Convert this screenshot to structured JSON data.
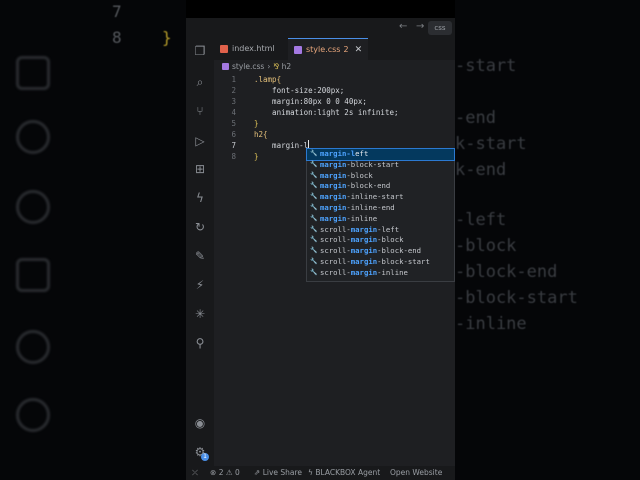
{
  "background": {
    "left_line_numbers": [
      "7",
      "8"
    ],
    "left_braces": [
      "}"
    ],
    "right_lines": [
      "-start",
      "-end",
      "k-start",
      "k-end",
      "-left",
      "-block",
      "-block-end",
      "-block-start",
      "-inline"
    ]
  },
  "titlebar": {
    "back": "←",
    "forward": "→",
    "command_label": "css"
  },
  "tabs": [
    {
      "label": "index.html",
      "badge": "",
      "active": false,
      "icon_color": "#e0614b"
    },
    {
      "label": "style.css",
      "badge": "2",
      "active": true,
      "icon_color": "#a479e2"
    }
  ],
  "breadcrumb": {
    "file": "style.css",
    "symbol_icon": "⅋",
    "symbol": "h2"
  },
  "code_lines": [
    {
      "n": "1",
      "text": ".lamp{"
    },
    {
      "n": "2",
      "text": "    font-size:200px;"
    },
    {
      "n": "3",
      "text": "    margin:80px 0 0 40px;"
    },
    {
      "n": "4",
      "text": "    animation:light 2s infinite;"
    },
    {
      "n": "5",
      "text": "}"
    },
    {
      "n": "6",
      "text": "h2{"
    },
    {
      "n": "7",
      "text": "    margin-l"
    },
    {
      "n": "8",
      "text": "}"
    }
  ],
  "suggestions": [
    {
      "pre": "",
      "match": "margin-l",
      "post": "eft"
    },
    {
      "pre": "",
      "match": "margin",
      "post": "-block-start"
    },
    {
      "pre": "",
      "match": "margin",
      "post": "-block"
    },
    {
      "pre": "",
      "match": "margin",
      "post": "-block-end"
    },
    {
      "pre": "",
      "match": "margin",
      "post": "-inline-start"
    },
    {
      "pre": "",
      "match": "margin",
      "post": "-inline-end"
    },
    {
      "pre": "",
      "match": "margin",
      "post": "-inline"
    },
    {
      "pre": "scroll-",
      "match": "margin",
      "post": "-left"
    },
    {
      "pre": "scroll-",
      "match": "margin",
      "post": "-block"
    },
    {
      "pre": "scroll-",
      "match": "margin",
      "post": "-block-end"
    },
    {
      "pre": "scroll-",
      "match": "margin",
      "post": "-block-start"
    },
    {
      "pre": "scroll-",
      "match": "margin",
      "post": "-inline"
    }
  ],
  "statusbar": {
    "remote": "⤫",
    "errors": "2",
    "warnings": "0",
    "live_share": "Live Share",
    "blackbox": "BLACKBOX Agent",
    "open_website": "Open Website"
  },
  "activity_badge": "1",
  "accent": "#4a8fe7"
}
